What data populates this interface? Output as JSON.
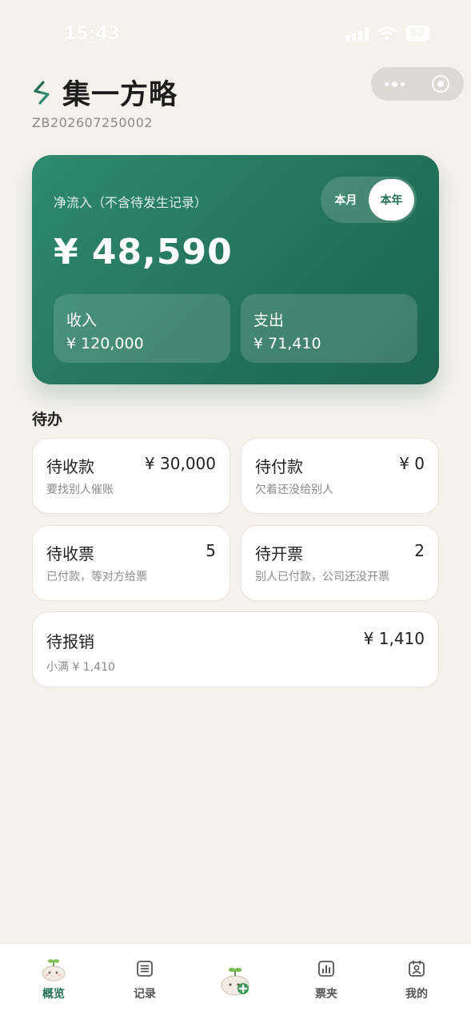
{
  "status_bar": {
    "time": "15:43",
    "battery": "88"
  },
  "header": {
    "title": "集一方略",
    "org_code": "ZB202607250002"
  },
  "summary": {
    "label": "净流入（不含待发生记录）",
    "period_month": "本月",
    "period_year": "本年",
    "active_period": "本年",
    "net_amount": "¥ 48,590",
    "income_title": "收入",
    "income_value": "¥ 120,000",
    "expense_title": "支出",
    "expense_value": "¥ 71,410"
  },
  "todo": {
    "section_title": "待办",
    "items": [
      {
        "name": "待收款",
        "value": "¥ 30,000",
        "desc": "要找别人催账"
      },
      {
        "name": "待付款",
        "value": "¥ 0",
        "desc": "欠着还没给别人"
      },
      {
        "name": "待收票",
        "value": "5",
        "desc": "已付款，等对方给票"
      },
      {
        "name": "待开票",
        "value": "2",
        "desc": "别人已付款，公司还没开票"
      },
      {
        "name": "待报销",
        "value": "¥ 1,410",
        "desc": "小满 ¥ 1,410"
      }
    ]
  },
  "tabbar": {
    "items": [
      {
        "label": "概览",
        "icon": "sprout-mascot-icon",
        "active": true
      },
      {
        "label": "记录",
        "icon": "list-icon"
      },
      {
        "label": "",
        "icon": "add-record-mascot-icon"
      },
      {
        "label": "票夹",
        "icon": "bar-chart-icon"
      },
      {
        "label": "我的",
        "icon": "profile-icon"
      }
    ]
  },
  "colors": {
    "primary": "#236e57",
    "background": "#f5f2ec",
    "card_border": "#ebe4d8"
  }
}
